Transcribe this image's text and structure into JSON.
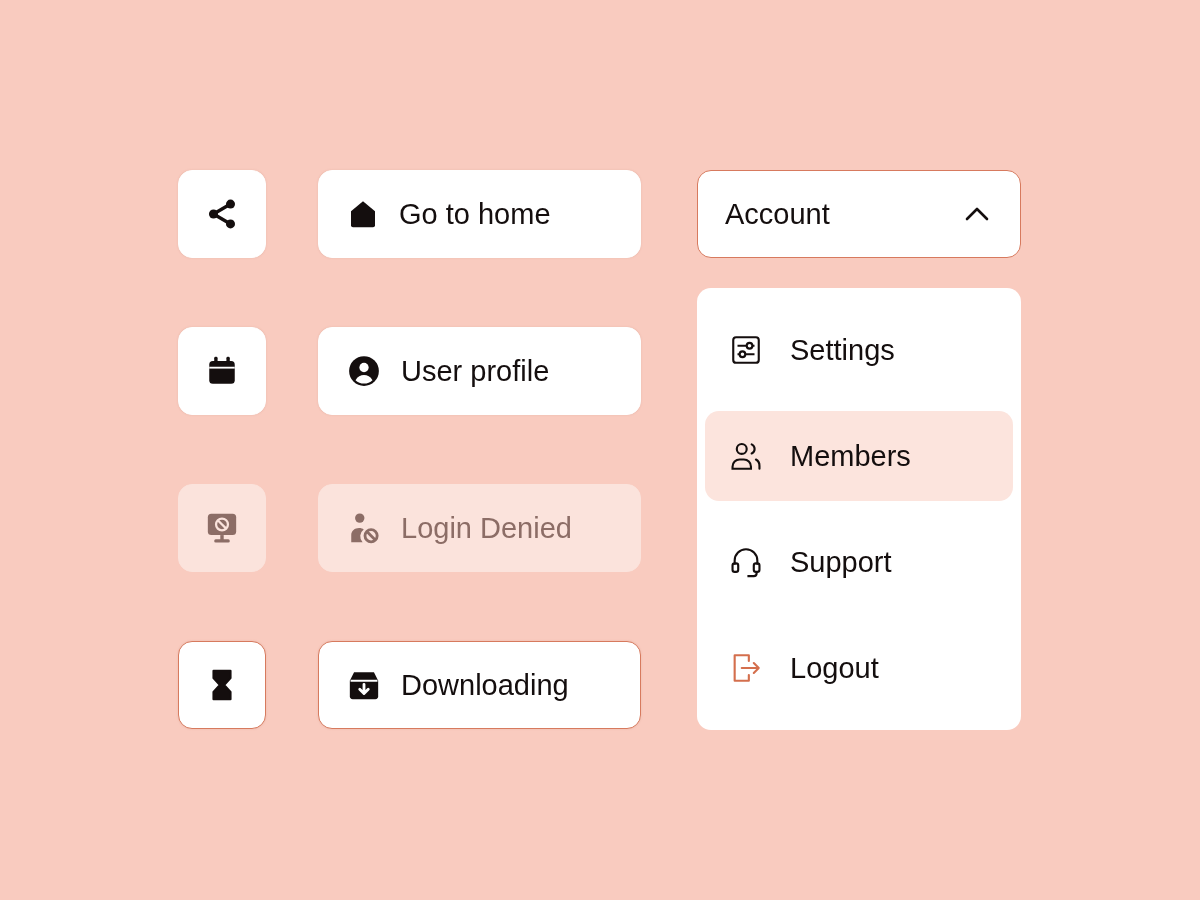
{
  "rows": [
    {
      "icon_button": {
        "disabled": false,
        "focused": false
      },
      "button": {
        "label": "Go to home",
        "disabled": false,
        "focused": false
      }
    },
    {
      "icon_button": {
        "disabled": false,
        "focused": false
      },
      "button": {
        "label": "User profile",
        "disabled": false,
        "focused": false
      }
    },
    {
      "icon_button": {
        "disabled": true,
        "focused": false
      },
      "button": {
        "label": "Login Denied",
        "disabled": true,
        "focused": false
      }
    },
    {
      "icon_button": {
        "disabled": false,
        "focused": true
      },
      "button": {
        "label": "Downloading",
        "disabled": false,
        "focused": true
      }
    }
  ],
  "dropdown": {
    "label": "Account",
    "expanded": true,
    "focused": true,
    "items": [
      {
        "label": "Settings",
        "selected": false
      },
      {
        "label": "Members",
        "selected": true
      },
      {
        "label": "Support",
        "selected": false
      },
      {
        "label": "Logout",
        "selected": false
      }
    ]
  }
}
